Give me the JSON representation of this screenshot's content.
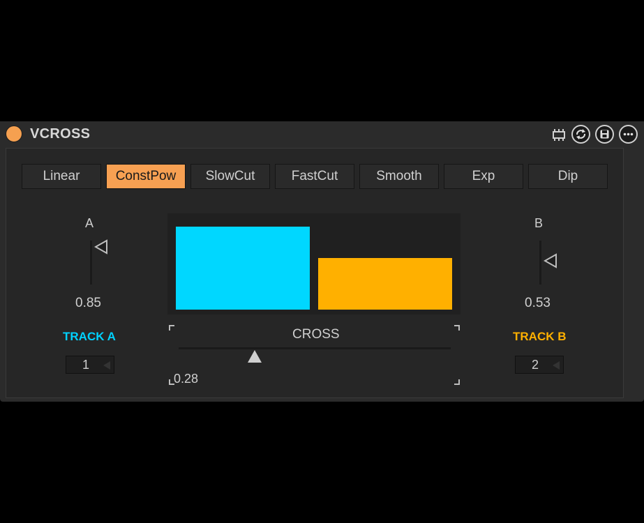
{
  "device": {
    "title": "VCROSS",
    "accent_color": "#f7a052",
    "header_icons": [
      "chip-icon",
      "refresh-icon",
      "save-icon",
      "more-icon"
    ]
  },
  "tabs": [
    {
      "label": "Linear",
      "active": false
    },
    {
      "label": "ConstPow",
      "active": true
    },
    {
      "label": "SlowCut",
      "active": false
    },
    {
      "label": "FastCut",
      "active": false
    },
    {
      "label": "Smooth",
      "active": false
    },
    {
      "label": "Exp",
      "active": false
    },
    {
      "label": "Dip",
      "active": false
    }
  ],
  "channel_a": {
    "label": "A",
    "gain": "0.85",
    "gain_level": 0.85,
    "track_label": "TRACK A",
    "track_color": "#00d2ff",
    "track_number": "1"
  },
  "channel_b": {
    "label": "B",
    "gain": "0.53",
    "gain_level": 0.53,
    "track_label": "TRACK B",
    "track_color": "#ffb000",
    "track_number": "2"
  },
  "crossfader": {
    "label": "CROSS",
    "value": "0.28",
    "position": 0.28
  }
}
